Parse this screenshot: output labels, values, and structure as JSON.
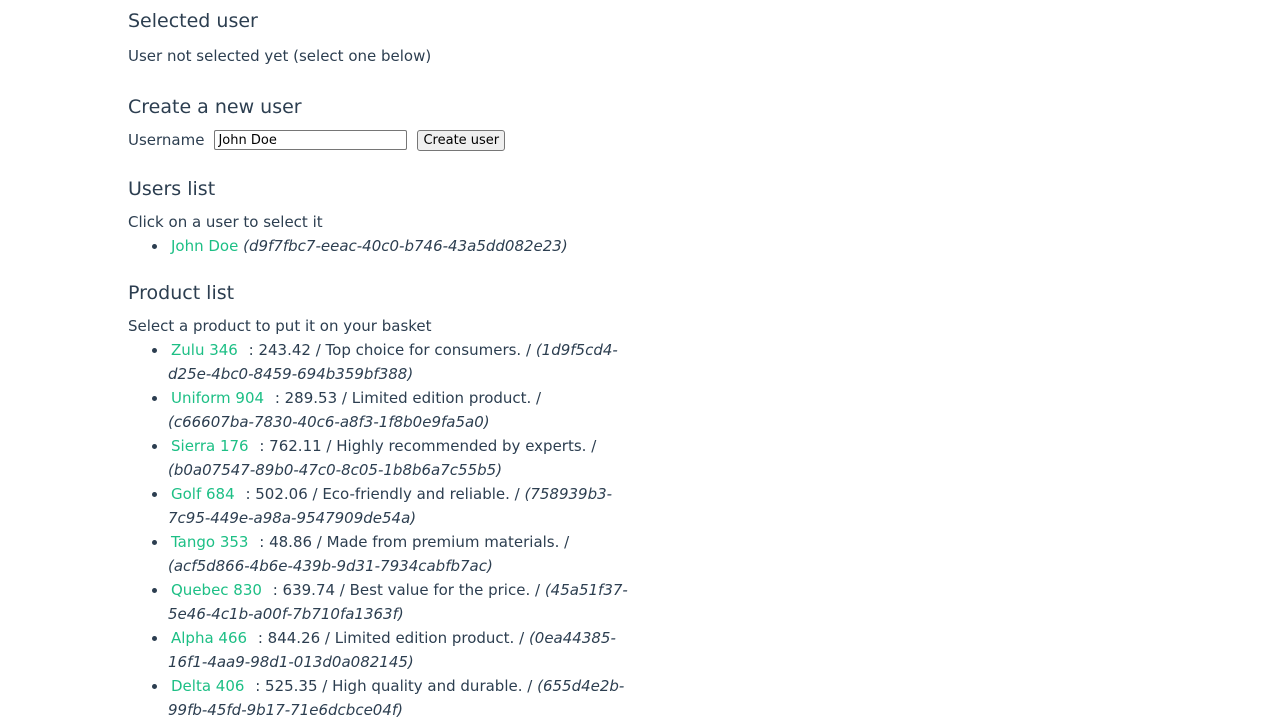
{
  "selected_user": {
    "heading": "Selected user",
    "status": "User not selected yet (select one below)"
  },
  "create_user": {
    "heading": "Create a new user",
    "username_label": "Username",
    "username_value": "John Doe",
    "button_label": "Create user"
  },
  "users_list": {
    "heading": "Users list",
    "help": "Click on a user to select it",
    "users": [
      {
        "name": "John Doe",
        "id": "(d9f7fbc7-eeac-40c0-b746-43a5dd082e23)"
      }
    ]
  },
  "product_list": {
    "heading": "Product list",
    "help": "Select a product to put it on your basket",
    "products": [
      {
        "name": "Zulu 346",
        "details": ": 243.42 / Top choice for consumers. /",
        "id": "(1d9f5cd4-d25e-4bc0-8459-694b359bf388)"
      },
      {
        "name": "Uniform 904",
        "details": ": 289.53 / Limited edition product. /",
        "id": "(c66607ba-7830-40c6-a8f3-1f8b0e9fa5a0)"
      },
      {
        "name": "Sierra 176",
        "details": ": 762.11 / Highly recommended by experts. /",
        "id": "(b0a07547-89b0-47c0-8c05-1b8b6a7c55b5)"
      },
      {
        "name": "Golf 684",
        "details": ": 502.06 / Eco-friendly and reliable. /",
        "id": "(758939b3-7c95-449e-a98a-9547909de54a)"
      },
      {
        "name": "Tango 353",
        "details": ": 48.86 / Made from premium materials. /",
        "id": "(acf5d866-4b6e-439b-9d31-7934cabfb7ac)"
      },
      {
        "name": "Quebec 830",
        "details": ": 639.74 / Best value for the price. /",
        "id": "(45a51f37-5e46-4c1b-a00f-7b710fa1363f)"
      },
      {
        "name": "Alpha 466",
        "details": ": 844.26 / Limited edition product. /",
        "id": "(0ea44385-16f1-4aa9-98d1-013d0a082145)"
      },
      {
        "name": "Delta 406",
        "details": ": 525.35 / High quality and durable. /",
        "id": "(655d4e2b-99fb-45fd-9b17-71e6dcbce04f)"
      }
    ]
  },
  "colors": {
    "text": "#2c3e50",
    "link": "#1dbf85"
  }
}
